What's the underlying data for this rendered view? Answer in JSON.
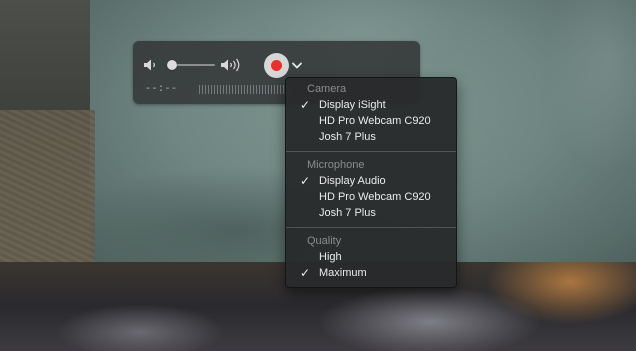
{
  "controls": {
    "icons": {
      "volume_low": "speaker-low-icon",
      "volume_high": "speaker-high-icon",
      "record": "record-icon",
      "options": "chevron-down-icon"
    },
    "volume_level": 0.0,
    "record_color": "#e8302c",
    "time": "--:--"
  },
  "menu": {
    "sections": [
      {
        "header": "Camera",
        "items": [
          {
            "label": "Display iSight",
            "checked": true
          },
          {
            "label": "HD Pro Webcam C920",
            "checked": false
          },
          {
            "label": "Josh 7 Plus",
            "checked": false
          }
        ]
      },
      {
        "header": "Microphone",
        "items": [
          {
            "label": "Display Audio",
            "checked": true
          },
          {
            "label": "HD Pro Webcam C920",
            "checked": false
          },
          {
            "label": "Josh 7 Plus",
            "checked": false
          }
        ]
      },
      {
        "header": "Quality",
        "items": [
          {
            "label": "High",
            "checked": false
          },
          {
            "label": "Maximum",
            "checked": true
          }
        ]
      }
    ],
    "checkmark": "✓"
  }
}
